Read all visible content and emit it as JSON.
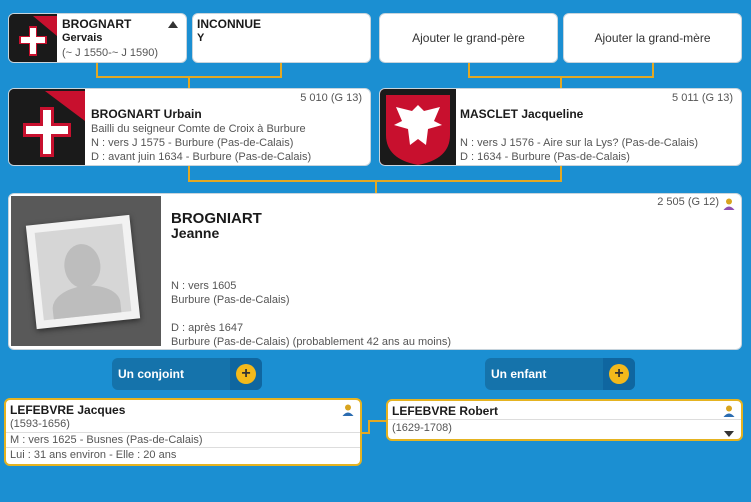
{
  "grandparents": [
    {
      "name": "BROGNART",
      "firstname": "Gervais",
      "dates": "(~ J 1550-~ J 1590)"
    },
    {
      "name": "INCONNUE",
      "firstname": "Y"
    },
    {
      "add_label": "Ajouter le grand-père"
    },
    {
      "add_label": "Ajouter la grand-mère"
    }
  ],
  "father": {
    "number": "5 010 (G 13)",
    "name": "BROGNART Urbain",
    "title": "Bailli du seigneur Comte de Croix à Burbure",
    "birth": "N : vers J 1575 - Burbure (Pas-de-Calais)",
    "death": "D : avant juin 1634 - Burbure (Pas-de-Calais)"
  },
  "mother": {
    "number": "5 011 (G 13)",
    "name": "MASCLET Jacqueline",
    "birth": "N : vers J 1576 - Aire sur la Lys? (Pas-de-Calais)",
    "death": "D : 1634 - Burbure (Pas-de-Calais)"
  },
  "main": {
    "number": "2 505 (G 12)",
    "surname": "BROGNIART",
    "firstname": "Jeanne",
    "birth_label": "N : vers 1605",
    "birth_place": "Burbure (Pas-de-Calais)",
    "death_label": "D : après 1647",
    "death_place": "Burbure (Pas-de-Calais) (probablement 42 ans au moins)"
  },
  "buttons": {
    "spouse": "Un conjoint",
    "child": "Un enfant",
    "plus": "+"
  },
  "spouse": {
    "name": "LEFEBVRE Jacques",
    "dates": "(1593-1656)",
    "marriage": "M : vers 1625 - Busnes (Pas-de-Calais)",
    "ages": "Lui : 31 ans environ - Elle : 20 ans"
  },
  "child": {
    "name": "LEFEBVRE Robert",
    "dates": "(1629-1708)"
  },
  "colors": {
    "background": "#1b8fd2",
    "connector": "#e3a823",
    "accent": "#f3b91b"
  }
}
